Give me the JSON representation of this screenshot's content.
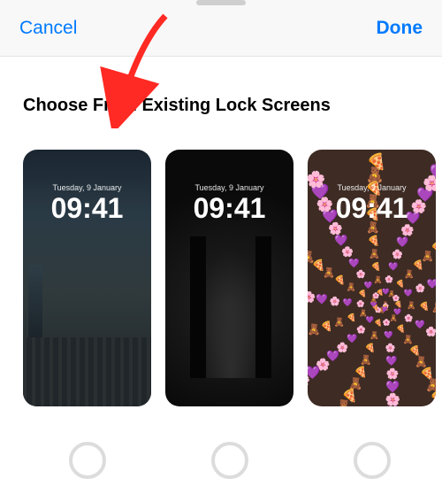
{
  "nav": {
    "cancel": "Cancel",
    "done": "Done"
  },
  "section_title": "Choose From Existing Lock Screens",
  "lock_screens": [
    {
      "id": "city",
      "date": "Tuesday, 9 January",
      "time": "09:41",
      "selected": false
    },
    {
      "id": "dark",
      "date": "Tuesday, 9 January",
      "time": "09:41",
      "selected": false
    },
    {
      "id": "emoji",
      "date": "Tuesday, 9 January",
      "time": "09:41",
      "selected": false
    }
  ],
  "arrow": {
    "color": "#ff2a23"
  }
}
